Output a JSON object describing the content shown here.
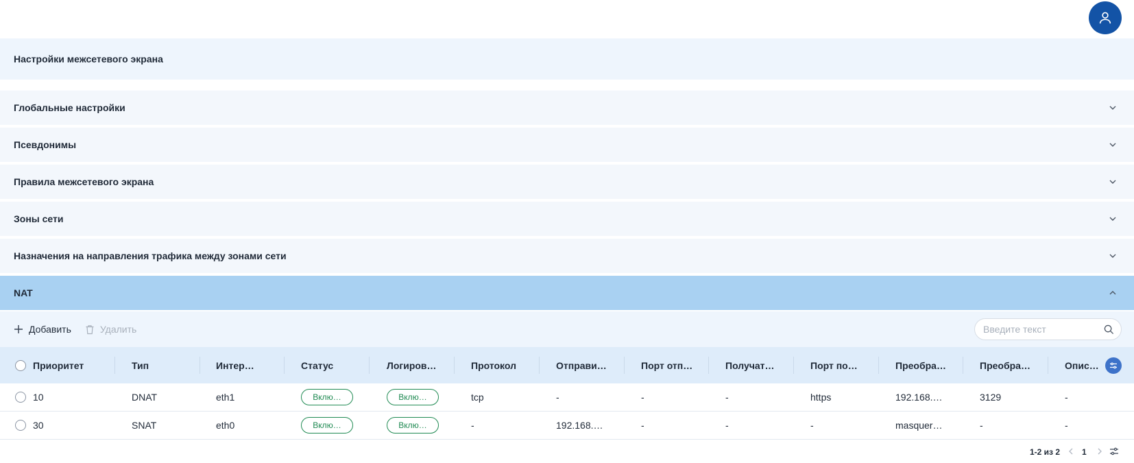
{
  "header": {
    "page_title": "Настройки межсетевого экрана"
  },
  "sections": [
    {
      "label": "Глобальные настройки",
      "expanded": false
    },
    {
      "label": "Псевдонимы",
      "expanded": false
    },
    {
      "label": "Правила межсетевого экрана",
      "expanded": false
    },
    {
      "label": "Зоны сети",
      "expanded": false
    },
    {
      "label": "Назначения на направления трафика между зонами сети",
      "expanded": false
    },
    {
      "label": "NAT",
      "expanded": true
    }
  ],
  "toolbar": {
    "add_label": "Добавить",
    "delete_label": "Удалить",
    "search_placeholder": "Введите текст"
  },
  "table": {
    "columns": [
      "Приоритет",
      "Тип",
      "Интер…",
      "Статус",
      "Логиров…",
      "Протокол",
      "Отправи…",
      "Порт отп…",
      "Получат…",
      "Порт по…",
      "Преобра…",
      "Преобра…",
      "Опис…"
    ],
    "rows": [
      {
        "priority": "10",
        "type": "DNAT",
        "interface": "eth1",
        "status": "Вклю…",
        "logging": "Вклю…",
        "protocol": "tcp",
        "sender": "-",
        "sender_port": "-",
        "receiver": "-",
        "receiver_port": "https",
        "trans1": "192.168.…",
        "trans2": "3129",
        "desc": "-"
      },
      {
        "priority": "30",
        "type": "SNAT",
        "interface": "eth0",
        "status": "Вклю…",
        "logging": "Вклю…",
        "protocol": "-",
        "sender": "192.168.…",
        "sender_port": "-",
        "receiver": "-",
        "receiver_port": "-",
        "trans1": "masquer…",
        "trans2": "-",
        "desc": "-"
      }
    ]
  },
  "pagination": {
    "range_text": "1-2 из 2",
    "page": "1"
  },
  "colors": {
    "accent": "#1353a6",
    "expanded_section": "#a9d1f2",
    "status_green": "#1f8a52"
  },
  "icons": [
    "user-icon",
    "chevron-down-icon",
    "chevron-up-icon",
    "plus-icon",
    "trash-icon",
    "search-icon",
    "column-settings-icon",
    "chevron-left-icon",
    "chevron-right-icon",
    "sliders-icon"
  ]
}
